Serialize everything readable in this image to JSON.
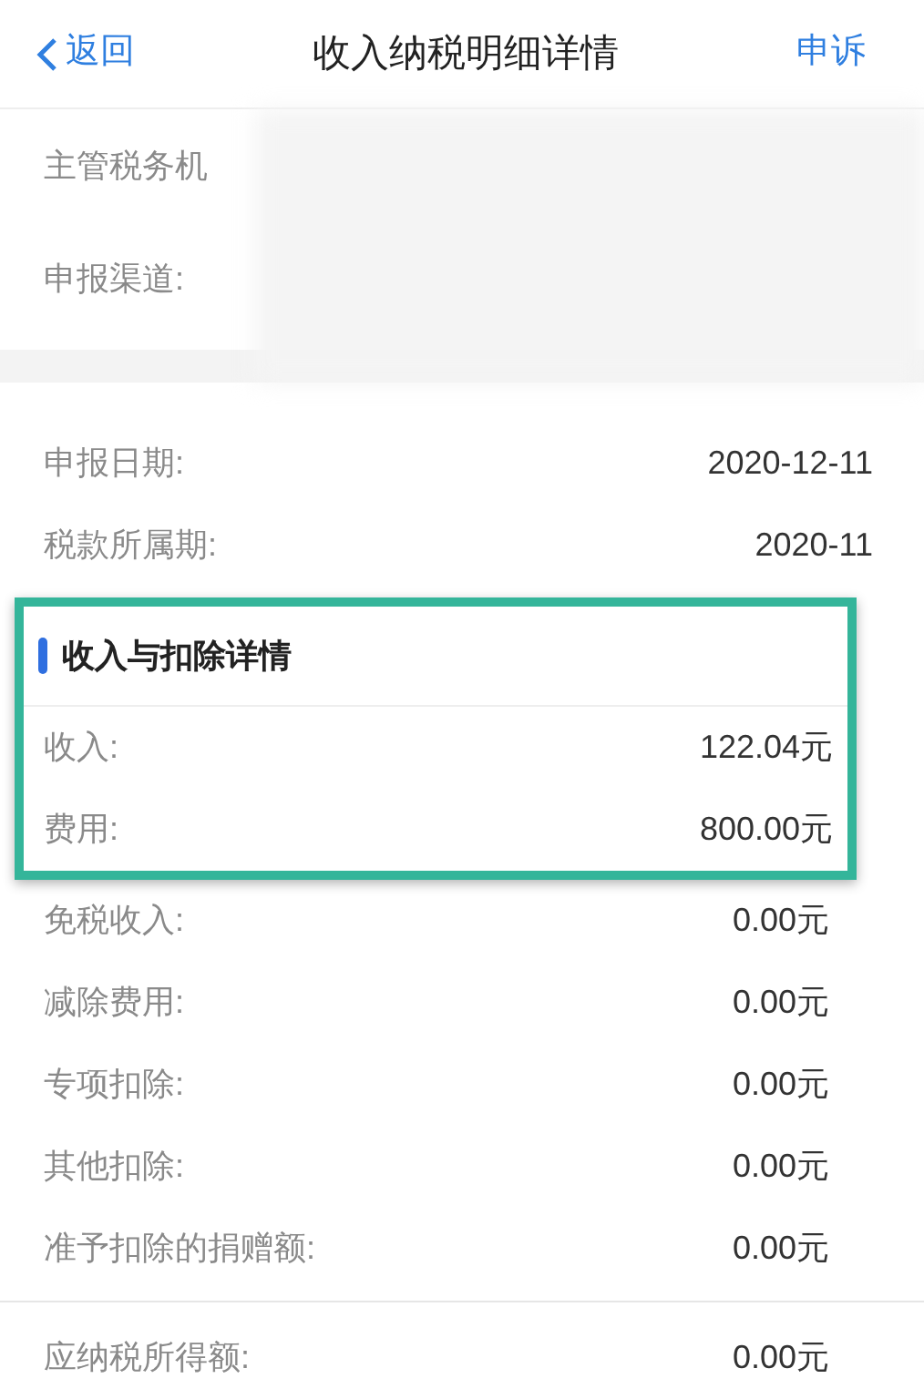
{
  "header": {
    "back": "返回",
    "title": "收入纳税明细详情",
    "action": "申诉"
  },
  "masked_rows": [
    {
      "label": "主管税务机"
    },
    {
      "label": "申报渠道:"
    }
  ],
  "date_rows": [
    {
      "label": "申报日期:",
      "value": "2020-12-11"
    },
    {
      "label": "税款所属期:",
      "value": "2020-11"
    }
  ],
  "section": {
    "title": "收入与扣除详情",
    "rows": [
      {
        "label": "收入:",
        "value": "122.04元"
      },
      {
        "label": "费用:",
        "value": "800.00元"
      }
    ]
  },
  "deduction_rows": [
    {
      "label": "免税收入:",
      "value": "0.00元"
    },
    {
      "label": "减除费用:",
      "value": "0.00元"
    },
    {
      "label": "专项扣除:",
      "value": "0.00元"
    },
    {
      "label": "其他扣除:",
      "value": "0.00元"
    },
    {
      "label": "准予扣除的捐赠额:",
      "value": "0.00元"
    }
  ],
  "total_row": {
    "label": "应纳税所得额:",
    "value": "0.00元"
  }
}
